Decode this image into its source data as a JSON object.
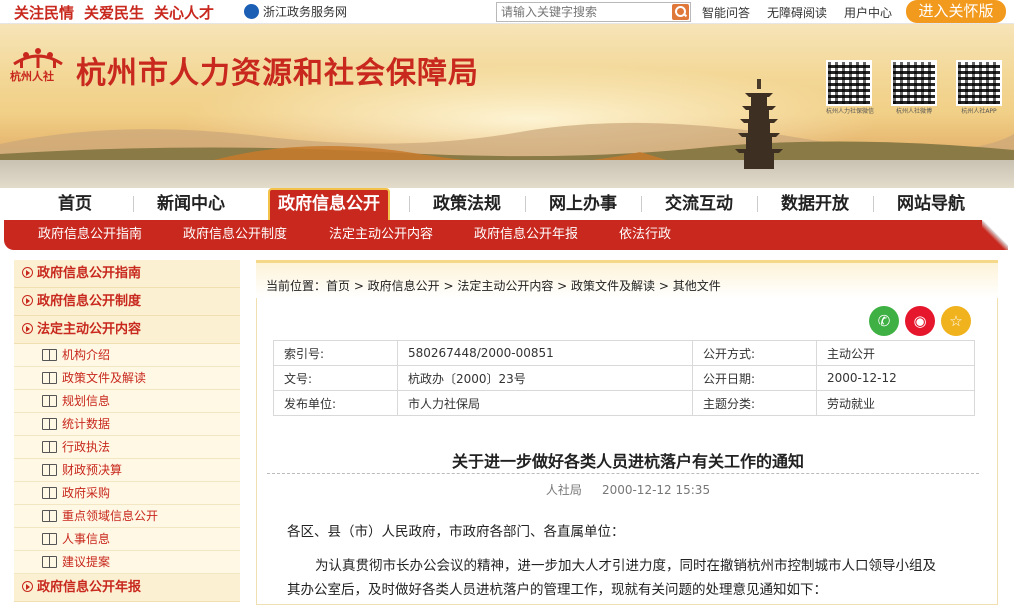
{
  "topbar": {
    "slogans": [
      "关注民情",
      "关爱民生",
      "关心人才"
    ],
    "zj_service": "浙江政务服务网",
    "search_placeholder": "请输入关键字搜索",
    "links": [
      "智能问答",
      "无障碍阅读",
      "用户中心"
    ],
    "care_mode": "进入关怀版"
  },
  "banner": {
    "logo_text": "杭州人社",
    "title": "杭州市人力资源和社会保障局",
    "qr_captions": [
      "杭州人力社保微信",
      "杭州人社微博",
      "杭州人社APP"
    ]
  },
  "nav": {
    "items": [
      "首页",
      "新闻中心",
      "政府信息公开",
      "政策法规",
      "网上办事",
      "交流互动",
      "数据开放",
      "网站导航"
    ],
    "active": "政府信息公开"
  },
  "subnav": [
    "政府信息公开指南",
    "政府信息公开制度",
    "法定主动公开内容",
    "政府信息公开年报",
    "依法行政"
  ],
  "sidebar": {
    "h1": "政府信息公开指南",
    "h2": "政府信息公开制度",
    "h3": "法定主动公开内容",
    "items": [
      "机构介绍",
      "政策文件及解读",
      "规划信息",
      "统计数据",
      "行政执法",
      "财政预决算",
      "政府采购",
      "重点领域信息公开",
      "人事信息",
      "建议提案"
    ],
    "h4": "政府信息公开年报"
  },
  "breadcrumb": "当前位置：首页 > 政府信息公开 > 法定主动公开内容 > 政策文件及解读 > 其他文件",
  "meta": {
    "r1": [
      "索引号:",
      "580267448/2000-00851",
      "公开方式:",
      "主动公开"
    ],
    "r2": [
      "文号:",
      "杭政办〔2000〕23号",
      "公开日期:",
      "2000-12-12"
    ],
    "r3": [
      "发布单位:",
      "市人力社保局",
      "主题分类:",
      "劳动就业"
    ]
  },
  "article": {
    "title": "关于进一步做好各类人员进杭落户有关工作的通知",
    "source": "人社局",
    "datetime": "2000-12-12 15:35",
    "p1": "各区、县（市）人民政府，市政府各部门、各直属单位：",
    "p2": "为认真贯彻市长办公会议的精神，进一步加大人才引进力度，同时在撤销杭州市控制城市人口领导小组及",
    "p3": "其办公室后，及时做好各类人员进杭落户的管理工作，现就有关问题的处理意见通知如下："
  },
  "colors": {
    "brand_red": "#c8281e",
    "accent_orange": "#f29a1d",
    "wechat": "#3fb144",
    "weibo": "#e6162d",
    "favorite": "#f0b21d"
  }
}
